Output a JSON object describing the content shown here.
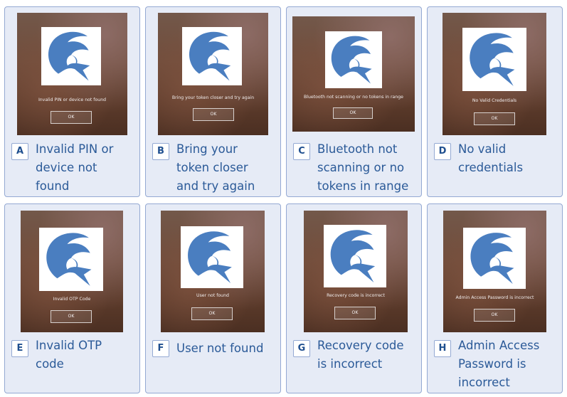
{
  "colors": {
    "card_background": "#e6ebf6",
    "card_border": "#94a9d3",
    "label_text": "#2b5a98",
    "letter_text": "#1f4f8f",
    "logo_blue": "#4a7ec0",
    "dialog_background": "#6e4c3b"
  },
  "icons": {
    "logo": "spartan-helmet-icon"
  },
  "cards": [
    {
      "letter": "A",
      "dialog_message": "Invalid PIN or device not found",
      "dialog_button": "OK",
      "description": "Invalid PIN or\ndevice not\nfound"
    },
    {
      "letter": "B",
      "dialog_message": "Bring your token closer and try again",
      "dialog_button": "OK",
      "description": "Bring your\ntoken closer\nand try again"
    },
    {
      "letter": "C",
      "dialog_message": "Bluetooth not scanning or no tokens in range",
      "dialog_button": "OK",
      "description": "Bluetooth not\nscanning or no\ntokens in range"
    },
    {
      "letter": "D",
      "dialog_message": "No Valid Credentials",
      "dialog_button": "OK",
      "description": "No valid\ncredentials"
    },
    {
      "letter": "E",
      "dialog_message": "Invalid OTP Code",
      "dialog_button": "OK",
      "description": "Invalid OTP\ncode"
    },
    {
      "letter": "F",
      "dialog_message": "User not found",
      "dialog_button": "OK",
      "description": "User not found"
    },
    {
      "letter": "G",
      "dialog_message": "Recovery code is incorrect",
      "dialog_button": "OK",
      "description": "Recovery code\nis incorrect"
    },
    {
      "letter": "H",
      "dialog_message": "Admin Access Password is incorrect",
      "dialog_button": "OK",
      "description": "Admin Access\nPassword is\nincorrect"
    }
  ]
}
